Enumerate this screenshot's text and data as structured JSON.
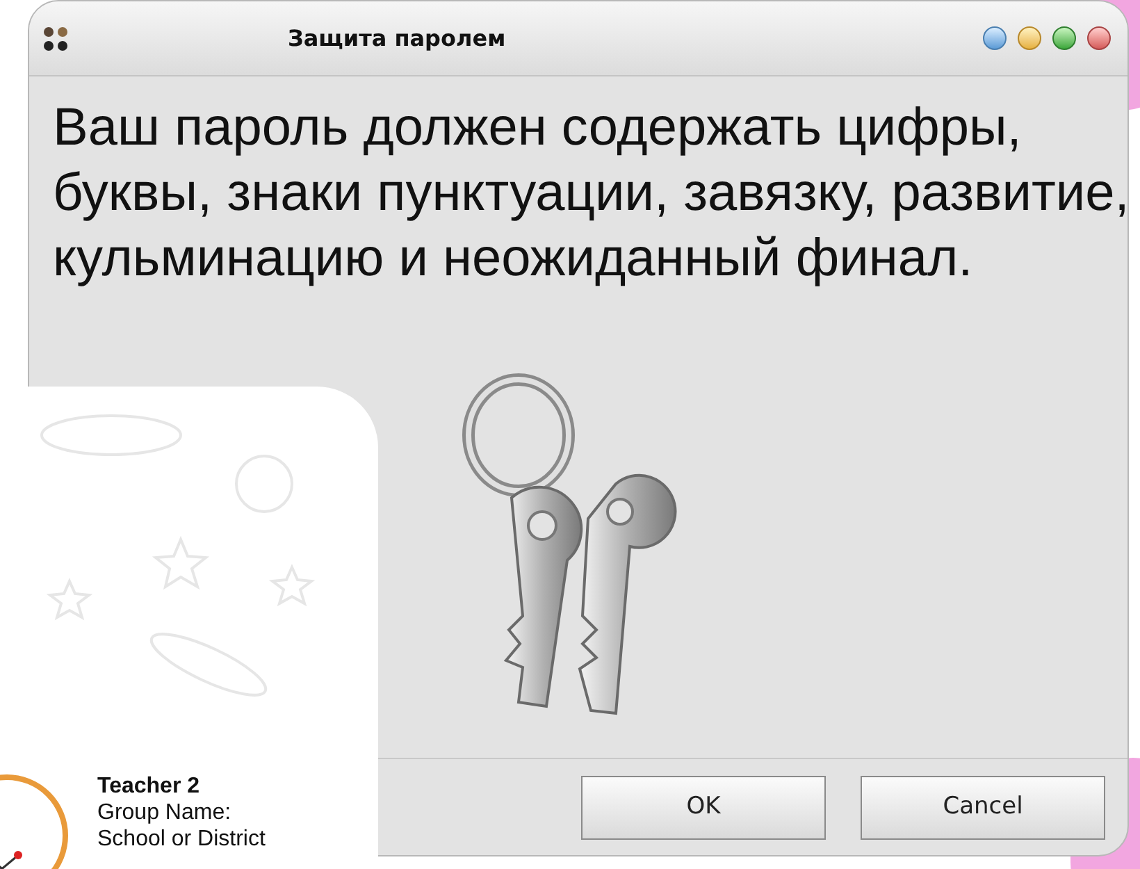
{
  "window": {
    "title": "Защита паролем"
  },
  "message": "Ваш пароль должен содержать цифры, буквы, знаки пунктуации, завязку, развитие, кульминацию и неожиданный финал.",
  "buttons": [
    {
      "label": "OK"
    },
    {
      "label": "Cancel"
    }
  ],
  "card": {
    "name": "Teacher 2",
    "lines": [
      "Group Name:",
      "School or District"
    ]
  }
}
